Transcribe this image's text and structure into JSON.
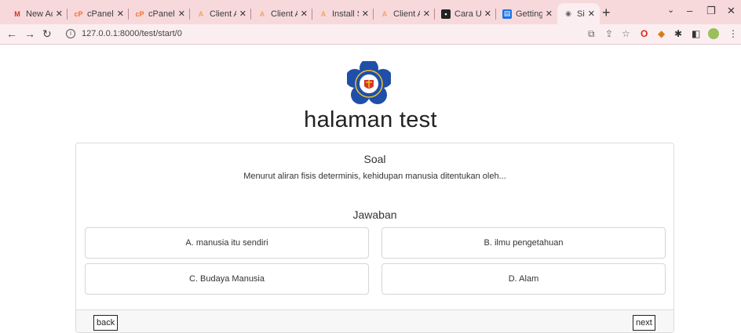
{
  "browser": {
    "tabs": [
      {
        "title": "New Ac",
        "icon": "gmail-icon",
        "color": "#d93025"
      },
      {
        "title": "cPanel -",
        "icon": "cpanel-icon",
        "color": "#ff6c2c"
      },
      {
        "title": "cPanel -",
        "icon": "cpanel-icon",
        "color": "#ff6c2c"
      },
      {
        "title": "Client A",
        "icon": "app-icon",
        "color": "#f4a261"
      },
      {
        "title": "Client A",
        "icon": "app-icon",
        "color": "#f4a261"
      },
      {
        "title": "Install S",
        "icon": "app-icon",
        "color": "#f4a261"
      },
      {
        "title": "Client A",
        "icon": "app-icon",
        "color": "#f4a261"
      },
      {
        "title": "Cara Up",
        "icon": "video-icon",
        "color": "#222222"
      },
      {
        "title": "Getting",
        "icon": "doc-icon",
        "color": "#1a73e8"
      },
      {
        "title": "Sistem",
        "icon": "globe-icon",
        "color": "#5f6368"
      }
    ],
    "url": "127.0.0.1:8000/test/start/0"
  },
  "page": {
    "title": "halaman test",
    "soal_label": "Soal",
    "question": "Menurut aliran fisis determinis, kehidupan manusia ditentukan oleh...",
    "jawaban_label": "Jawaban",
    "answers": [
      "A. manusia itu sendiri",
      "B. ilmu pengetahuan",
      "C. Budaya Manusia",
      "D. Alam"
    ],
    "back_label": "back",
    "next_label": "next"
  },
  "colors": {
    "tabstrip": "#f7d9dc",
    "toolbar": "#fbeef0",
    "logo_blue": "#1f4fa8",
    "logo_gold": "#f2c12e"
  }
}
